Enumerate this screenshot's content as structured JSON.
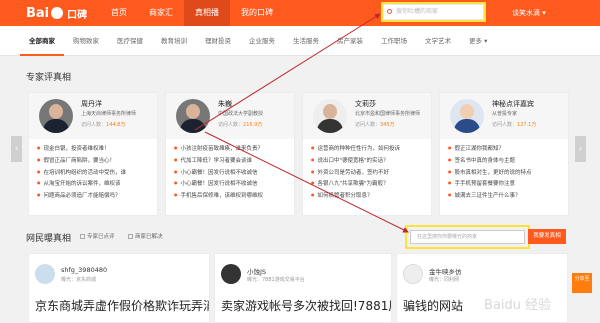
{
  "header": {
    "logo": {
      "left": "Bai",
      "right": "口碑"
    },
    "nav": [
      "首页",
      "商家汇",
      "真相播",
      "我的口碑"
    ],
    "search_placeholder": "搜你吐槽的商家",
    "user": "谈笑水滴 ▾"
  },
  "tabs": [
    "全部商家",
    "购物致家",
    "医疗保健",
    "教育培训",
    "理财投资",
    "企业服务",
    "生活服务",
    "房产家装",
    "工作职场",
    "文学艺术",
    "更多 ▾"
  ],
  "expert_section": {
    "title": "专家评真相",
    "prev": "‹",
    "next": "›",
    "stats_label": "访问人数",
    "experts": [
      {
        "name": "周丹洋",
        "title": "上海天尚律师事务所律师",
        "visits": "144.8万",
        "items": [
          "现金白银，投资者维权难！",
          "假冒正品厂商陷阱，要当心！",
          "在培训机构组织的活动中受伤，谁",
          "从淘宝开始的诉讼案件，维权该",
          "问题商品必须追厂才能赔偿吗？"
        ]
      },
      {
        "name": "朱巍",
        "title": "中国政法大学副教授",
        "visits": "216.9万",
        "items": [
          "小孩注射疫苗致瘫痪，谁来负责？",
          "代加工降低？学习者要会谈谁",
          "小心霸餐！因发行说相不收诚信",
          "小心霸餐！因发行说相不收诚信",
          "手机售后保修难，该维权到哪维权"
        ]
      },
      {
        "name": "文莉莎",
        "title": "北京市盈和国律师事务所律师",
        "visits": "345万",
        "items": [
          "运营商的种种任性行为，如何投诉",
          "说出口中\"德使宽格\"的实话？",
          "外资公司是劳动者，签约不好",
          "各银八九\"共享欺骗\"为霸般？",
          "如何机管者积分取息？"
        ]
      },
      {
        "name": "神秘点评嘉宾",
        "title": "从普投专家",
        "visits": "127.1万",
        "items": [
          "假正江湖你我都知？",
          "签名书中真的身体与主题",
          "股市真相对生，更好的说的特点",
          "手手机预留套餐要你注意",
          "城满去三证件生产什么事？"
        ]
      }
    ]
  },
  "exposure_section": {
    "title": "网民曝真相",
    "filter_commented": "专家已点评",
    "filter_resolved": "商家已解决",
    "input_placeholder": "在这里搜你你要曝光的商家",
    "button": "我要发真相",
    "posts": [
      {
        "name": "shfg_3980480",
        "sub": "曝光：京东商城",
        "title": "京东商城弄虚作假价格欺诈玩弄消"
      },
      {
        "name": "小蚀JS",
        "sub": "曝光：7881游戏交易平台",
        "title": "卖家游戏帐号多次被找回!7881居然"
      },
      {
        "name": "金牛映乡仿",
        "sub": "曝光：同利网",
        "title": "骗钱的网站"
      }
    ]
  },
  "share": "分享至",
  "watermark": "Baidu 经验",
  "colors": {
    "accent": "#ff5a1e",
    "highlight": "#ffe23a",
    "annotation": "#c0282d"
  }
}
